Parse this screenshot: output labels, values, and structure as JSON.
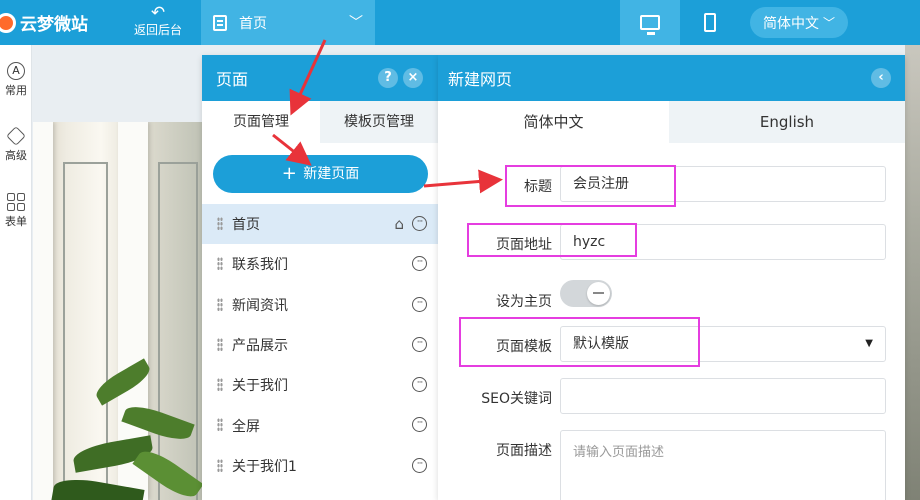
{
  "topbar": {
    "logo_text": "云梦微站",
    "back_label": "返回后台",
    "back_icon": "undo-arrow-icon",
    "page_select_value": "首页",
    "lang_value": "简体中文",
    "accent_color": "#1c9fd8"
  },
  "lefttool": {
    "items": [
      {
        "label": "常用",
        "icon": "a-circle-icon"
      },
      {
        "label": "高级",
        "icon": "diamond-icon"
      },
      {
        "label": "表单",
        "icon": "grid-icon"
      }
    ]
  },
  "page_manager": {
    "title": "页面",
    "help_label": "?",
    "close_label": "×",
    "tabs": [
      "页面管理",
      "模板页管理"
    ],
    "new_page_label": "新建页面",
    "pages": [
      {
        "name": "首页",
        "is_home": true
      },
      {
        "name": "联系我们"
      },
      {
        "name": "新闻资讯"
      },
      {
        "name": "产品展示"
      },
      {
        "name": "关于我们"
      },
      {
        "name": "全屏"
      },
      {
        "name": "关于我们1"
      }
    ]
  },
  "new_page": {
    "title": "新建网页",
    "tabs": [
      "简体中文",
      "English"
    ],
    "fields": {
      "title_label": "标题",
      "title_value": "会员注册",
      "url_label": "页面地址",
      "url_value": "hyzc",
      "home_label": "设为主页",
      "home_enabled": false,
      "template_label": "页面模板",
      "template_value": "默认模版",
      "seo_label": "SEO关键词",
      "seo_value": "",
      "desc_label": "页面描述",
      "desc_placeholder": "请输入页面描述"
    }
  }
}
